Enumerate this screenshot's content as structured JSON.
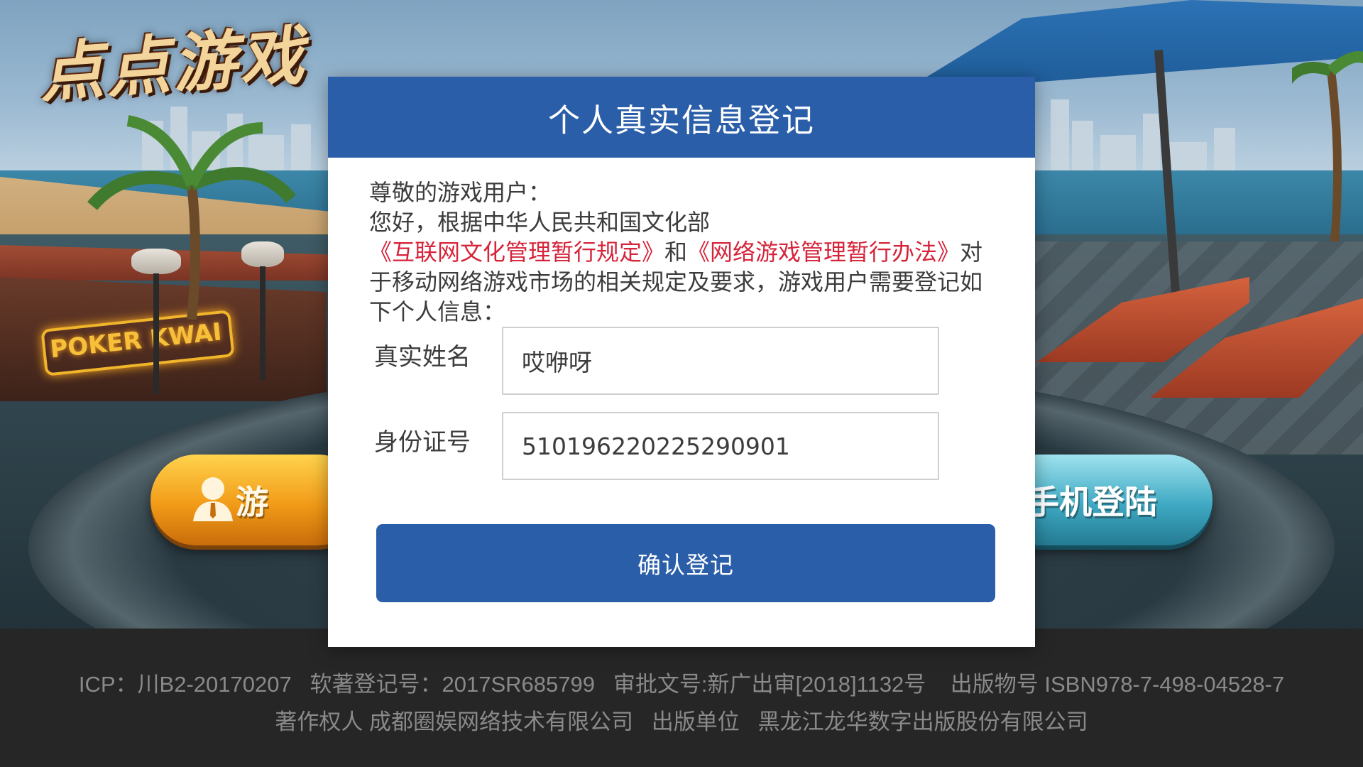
{
  "app": {
    "logo_text": "点点游戏",
    "sign_text": "POKER KWAI"
  },
  "background_buttons": {
    "guest_login_label": "游",
    "phone_login_label": "手机登陆"
  },
  "modal": {
    "title": "个人真实信息登记",
    "greeting": "尊敬的游戏用户：",
    "intro_part1": "您好，根据中华人民共和国文化部",
    "law1": "《互联网文化管理暂行规定》",
    "intro_and": "和",
    "law2": "《网络游戏管理暂行办法》",
    "intro_part2": "对于移动网络游戏市场的相关规定及要求，游戏用户需要登记如下个人信息：",
    "name_label": "真实姓名",
    "name_value": "哎咿呀",
    "id_label": "身份证号",
    "id_value": "510196220225290901",
    "confirm_label": "确认登记"
  },
  "footer": {
    "line1": "ICP：川B2-20170207   软著登记号：2017SR685799   审批文号:新广出审[2018]1132号    出版物号 ISBN978-7-498-04528-7",
    "line2": "著作权人 成都圈娱网络技术有限公司   出版单位   黑龙江龙华数字出版股份有限公司"
  },
  "colors": {
    "header_blue": "#2a5ea8",
    "law_red": "#d6243a",
    "footer_bg": "#262626",
    "footer_text": "#8a8a8a"
  }
}
